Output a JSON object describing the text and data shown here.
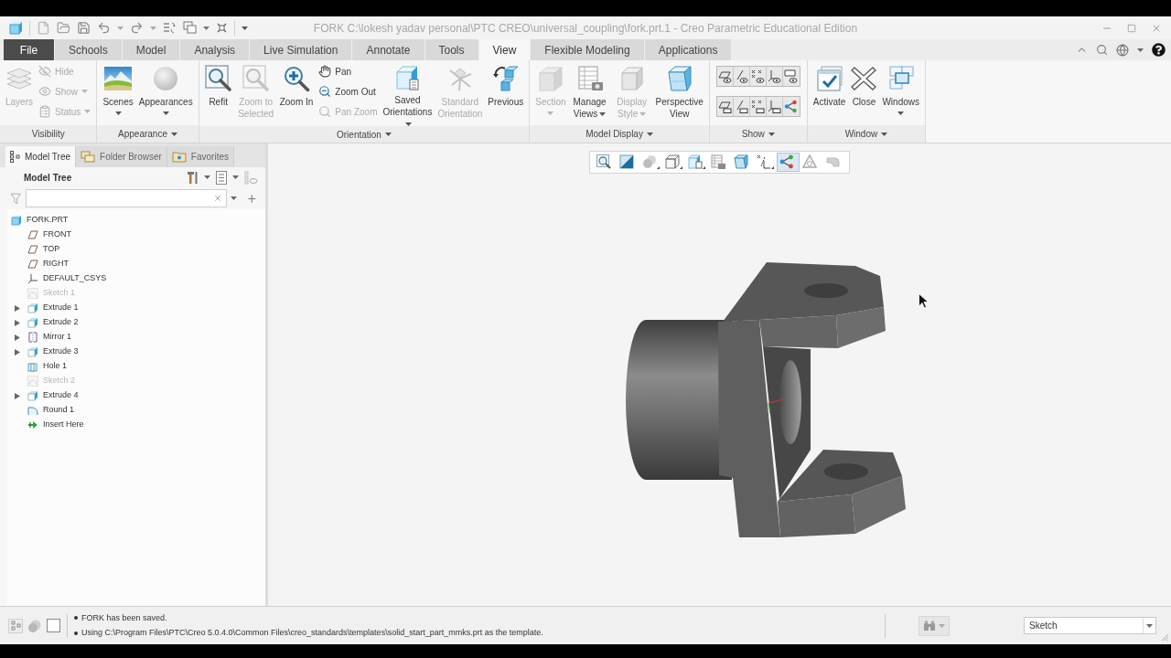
{
  "title_bar": {
    "title": "FORK C:\\lokesh yadav personal\\PTC CREO\\universal_coupling\\fork.prt.1 - Creo Parametric Educational Edition"
  },
  "ribbon_tabs": [
    {
      "label": "File",
      "kind": "file",
      "selected": false
    },
    {
      "label": "Schools",
      "kind": "tab",
      "selected": false
    },
    {
      "label": "Model",
      "kind": "tab",
      "selected": false
    },
    {
      "label": "Analysis",
      "kind": "tab",
      "selected": false
    },
    {
      "label": "Live Simulation",
      "kind": "tab",
      "selected": false
    },
    {
      "label": "Annotate",
      "kind": "tab",
      "selected": false
    },
    {
      "label": "Tools",
      "kind": "tab",
      "selected": false
    },
    {
      "label": "View",
      "kind": "tab",
      "selected": true
    },
    {
      "label": "Flexible Modeling",
      "kind": "tab",
      "selected": false
    },
    {
      "label": "Applications",
      "kind": "tab",
      "selected": false
    }
  ],
  "ribbon_groups": [
    {
      "label": "Visibility",
      "menu": false,
      "kind": "buttons",
      "items": [
        {
          "kind": "large",
          "label": "Layers",
          "disabled": true,
          "dropdown": false
        },
        {
          "kind": "stack",
          "items": [
            {
              "label": "Hide",
              "disabled": true,
              "dropdown": false
            },
            {
              "label": "Show",
              "disabled": true,
              "dropdown": true
            },
            {
              "label": "Status",
              "disabled": true,
              "dropdown": true
            }
          ]
        }
      ]
    },
    {
      "label": "Appearance",
      "menu": true,
      "kind": "buttons",
      "items": [
        {
          "kind": "large",
          "label": "Scenes",
          "disabled": false,
          "dropdown": true
        },
        {
          "kind": "large",
          "label": "Appearances",
          "disabled": false,
          "dropdown": true
        }
      ]
    },
    {
      "label": "Orientation",
      "menu": true,
      "kind": "buttons",
      "items": [
        {
          "kind": "large",
          "label": "Refit",
          "disabled": false,
          "dropdown": false
        },
        {
          "kind": "large",
          "label": "Zoom to Selected",
          "disabled": true,
          "dropdown": false
        },
        {
          "kind": "large",
          "label": "Zoom In",
          "disabled": false,
          "dropdown": false
        },
        {
          "kind": "stack",
          "items": [
            {
              "label": "Pan",
              "disabled": false,
              "dropdown": false
            },
            {
              "label": "Zoom Out",
              "disabled": false,
              "dropdown": false
            },
            {
              "label": "Pan Zoom",
              "disabled": true,
              "dropdown": false
            }
          ]
        },
        {
          "kind": "large",
          "label": "Saved Orientations",
          "disabled": false,
          "dropdown": true
        },
        {
          "kind": "large",
          "label": "Standard Orientation",
          "disabled": true,
          "dropdown": false
        },
        {
          "kind": "large",
          "label": "Previous",
          "disabled": false,
          "dropdown": false
        }
      ]
    },
    {
      "label": "Model Display",
      "menu": true,
      "kind": "buttons",
      "items": [
        {
          "kind": "large",
          "label": "Section",
          "disabled": true,
          "dropdown": true
        },
        {
          "kind": "large",
          "label": "Manage Views",
          "disabled": false,
          "dropdown": true
        },
        {
          "kind": "large",
          "label": "Display Style",
          "disabled": true,
          "dropdown": true
        },
        {
          "kind": "large",
          "label": "Perspective View",
          "disabled": false,
          "dropdown": false
        }
      ]
    },
    {
      "label": "Show",
      "menu": true,
      "kind": "icon_grid"
    },
    {
      "label": "Window",
      "menu": true,
      "kind": "buttons",
      "items": [
        {
          "kind": "large",
          "label": "Activate",
          "disabled": false,
          "dropdown": false
        },
        {
          "kind": "large",
          "label": "Close",
          "disabled": false,
          "dropdown": false
        },
        {
          "kind": "large",
          "label": "Windows",
          "disabled": false,
          "dropdown": true
        }
      ]
    }
  ],
  "model_tree": {
    "tabs": [
      {
        "label": "Model Tree",
        "selected": true
      },
      {
        "label": "Folder Browser",
        "selected": false
      },
      {
        "label": "Favorites",
        "selected": false
      }
    ],
    "title": "Model Tree",
    "items": [
      {
        "label": "FORK.PRT",
        "kind": "part",
        "expandable": false,
        "hidden": false,
        "children": [
          {
            "label": "FRONT",
            "kind": "plane",
            "expandable": false,
            "hidden": false
          },
          {
            "label": "TOP",
            "kind": "plane",
            "expandable": false,
            "hidden": false
          },
          {
            "label": "RIGHT",
            "kind": "plane",
            "expandable": false,
            "hidden": false
          },
          {
            "label": "DEFAULT_CSYS",
            "kind": "csys",
            "expandable": false,
            "hidden": false
          },
          {
            "label": "Sketch 1",
            "kind": "sketch",
            "expandable": false,
            "hidden": true
          },
          {
            "label": "Extrude 1",
            "kind": "extrude",
            "expandable": true,
            "hidden": false
          },
          {
            "label": "Extrude 2",
            "kind": "extrude",
            "expandable": true,
            "hidden": false
          },
          {
            "label": "Mirror 1",
            "kind": "mirror",
            "expandable": true,
            "hidden": false
          },
          {
            "label": "Extrude 3",
            "kind": "extrude",
            "expandable": true,
            "hidden": false
          },
          {
            "label": "Hole 1",
            "kind": "hole",
            "expandable": false,
            "hidden": false
          },
          {
            "label": "Sketch 2",
            "kind": "sketch",
            "expandable": false,
            "hidden": true
          },
          {
            "label": "Extrude 4",
            "kind": "extrude",
            "expandable": true,
            "hidden": false
          },
          {
            "label": "Round 1",
            "kind": "round",
            "expandable": false,
            "hidden": false
          },
          {
            "label": "Insert Here",
            "kind": "insert",
            "expandable": false,
            "hidden": false
          }
        ]
      }
    ]
  },
  "view_toolbar": [
    {
      "selected": false,
      "dropdown": false
    },
    {
      "selected": false,
      "dropdown": false
    },
    {
      "selected": false,
      "dropdown": true
    },
    {
      "selected": false,
      "dropdown": true
    },
    {
      "selected": false,
      "dropdown": true
    },
    {
      "selected": false,
      "dropdown": false
    },
    {
      "selected": false,
      "dropdown": false
    },
    {
      "selected": false,
      "dropdown": true
    },
    {
      "selected": true,
      "dropdown": false
    },
    {
      "selected": false,
      "dropdown": false
    },
    {
      "selected": false,
      "dropdown": false
    }
  ],
  "status_bar": {
    "messages": [
      "FORK has been saved.",
      "Using C:\\Program Files\\PTC\\Creo 5.0.4.0\\Common Files\\creo_standards\\templates\\solid_start_part_mmks.prt as the template."
    ],
    "selection_filter": "Sketch"
  }
}
